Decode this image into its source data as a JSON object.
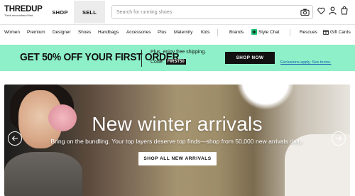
{
  "header": {
    "logo_name": "THREDUP",
    "logo_tagline": "Think secondhand first.",
    "shop_label": "SHOP",
    "sell_label": "SELL",
    "search_placeholder": "Search for running shoes",
    "icons": [
      "camera-icon",
      "heart-icon",
      "user-icon",
      "cart-icon"
    ]
  },
  "nav": {
    "items": [
      "Women",
      "Premium",
      "Designer",
      "Shoes",
      "Handbags",
      "Accessories",
      "Plus",
      "Maternity",
      "Kids"
    ],
    "right_items": [
      "Brands",
      "Style Chat",
      "Rescues",
      "Gift Cards"
    ]
  },
  "promo": {
    "headline": "GET 50% OFF YOUR FIRST ORDER",
    "line1": "Plus, enjoy free shipping.",
    "code_label": "Code:",
    "code": "FIRST50",
    "button": "SHOP NOW",
    "exclusions": "Exclusions apply. See terms.",
    "bg_color": "#8df0c8"
  },
  "hero": {
    "title": "New winter arrivals",
    "subtitle": "Bring on the bundling. Your top layers deserve top finds—shop from 50,000 new arrivals daily.",
    "cta": "SHOP ALL NEW ARRIVALS"
  }
}
